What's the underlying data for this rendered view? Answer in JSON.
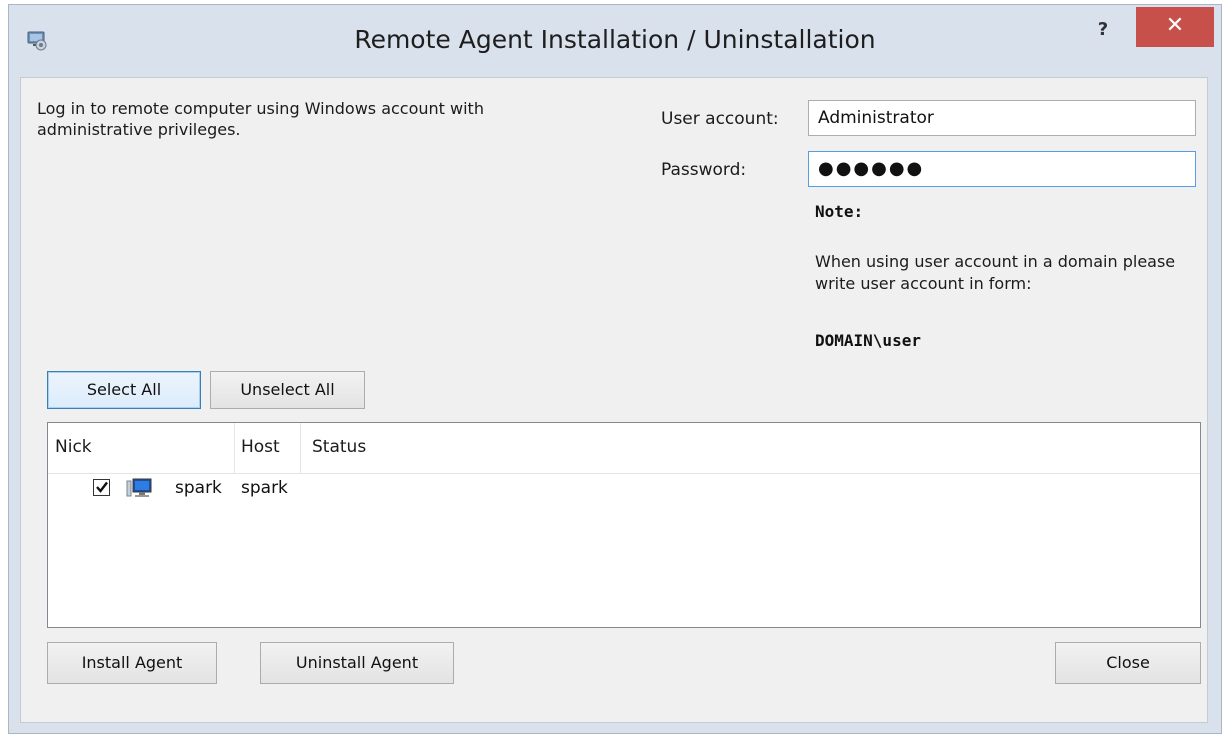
{
  "window": {
    "title": "Remote Agent Installation / Uninstallation",
    "help_label": "?",
    "close_label": "✕"
  },
  "intro_text": "Log in to remote computer using Windows account with administrative privileges.",
  "credentials": {
    "user_account_label": "User account:",
    "user_account_value": "Administrator",
    "password_label": "Password:",
    "password_value": "●●●●●●"
  },
  "note": {
    "title": "Note:",
    "text": "When using user account in a domain please write user account in form:",
    "domain_format": "DOMAIN\\user"
  },
  "selection": {
    "select_all_label": "Select All",
    "unselect_all_label": "Unselect All"
  },
  "table": {
    "columns": [
      "Nick",
      "Host",
      "Status"
    ],
    "rows": [
      {
        "checked": true,
        "nick": "spark",
        "host": "spark",
        "status": ""
      }
    ]
  },
  "actions": {
    "install_label": "Install Agent",
    "uninstall_label": "Uninstall Agent",
    "close_label": "Close"
  },
  "colors": {
    "title_bg": "#d9e1ec",
    "close_red": "#c7504a",
    "dialog_bg": "#f0f0f0"
  },
  "icons": [
    "app-icon",
    "help-icon",
    "close-icon",
    "computer-icon",
    "checkmark-icon"
  ]
}
